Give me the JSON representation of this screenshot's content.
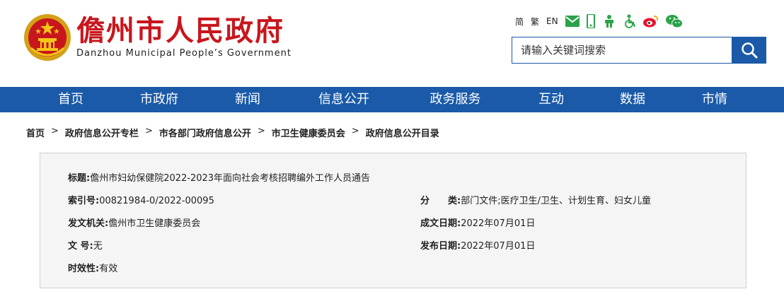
{
  "header": {
    "title_cn": "儋州市人民政府",
    "title_en": "Danzhou Municipal People’s Government",
    "lang_simplified": "简",
    "lang_traditional": "繁",
    "lang_english": "EN",
    "icons": [
      "mail-icon",
      "mobile-icon",
      "accessibility-icon",
      "wheelchair-icon",
      "weibo-icon",
      "wechat-icon"
    ],
    "search_placeholder": "请输入关键词搜索"
  },
  "colors": {
    "brand_blue": "#1a5aa8",
    "brand_red": "#c8161d",
    "box_bg": "#f5f5f5"
  },
  "nav": {
    "items": [
      "首页",
      "市政府",
      "新闻",
      "信息公开",
      "政务服务",
      "互动",
      "数据",
      "市情"
    ]
  },
  "breadcrumb": {
    "items": [
      "首页",
      "政府信息公开专栏",
      "市各部门政府信息公开",
      "市卫生健康委员会",
      "政府信息公开目录"
    ],
    "separator": ">"
  },
  "info": {
    "title_label": "标题:",
    "title_value": "儋州市妇幼保健院2022-2023年面向社会考核招聘编外工作人员通告",
    "index_label": "索引号:",
    "index_value": "00821984-0/2022-00095",
    "category_label": "分　　类:",
    "category_value": "部门文件;医疗卫生/卫生、计划生育、妇女儿童",
    "issuer_label": "发文机关:",
    "issuer_value": "儋州市卫生健康委员会",
    "created_label": "成文日期:",
    "created_value": "2022年07月01日",
    "docno_label": "文 号:",
    "docno_value": "无",
    "published_label": "发布日期:",
    "published_value": "2022年07月01日",
    "validity_label": "时效性:",
    "validity_value": "有效"
  }
}
